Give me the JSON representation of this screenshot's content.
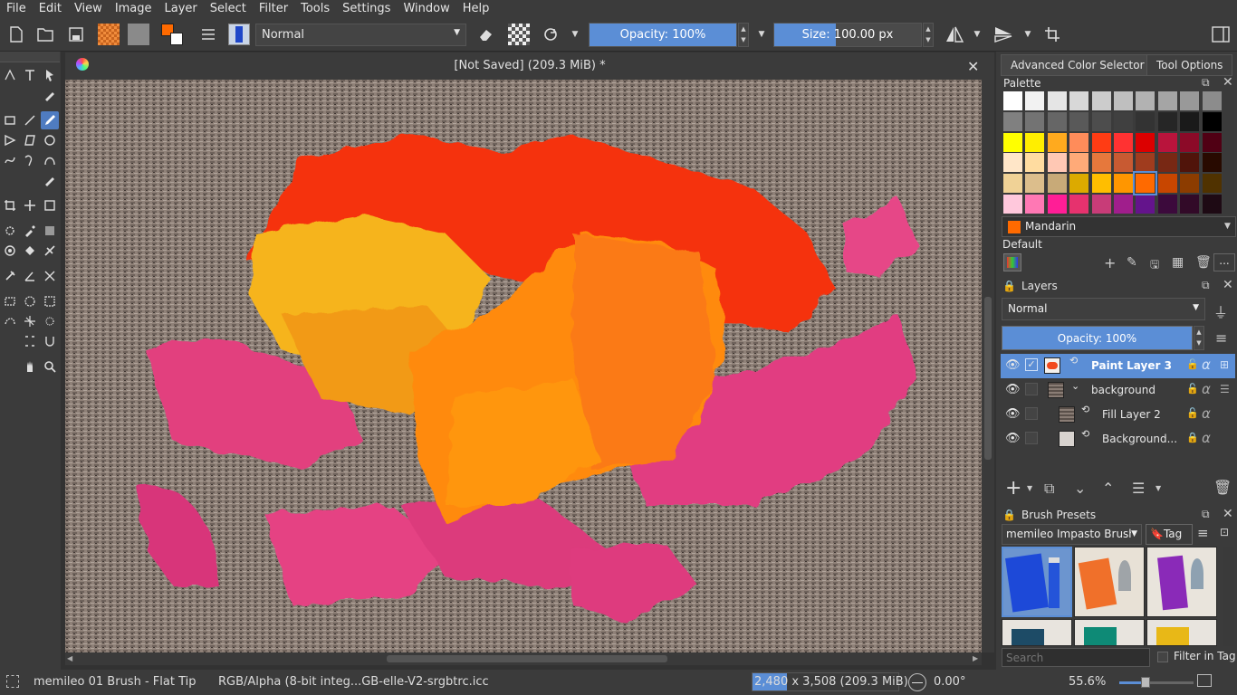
{
  "menu": [
    "File",
    "Edit",
    "View",
    "Image",
    "Layer",
    "Select",
    "Filter",
    "Tools",
    "Settings",
    "Window",
    "Help"
  ],
  "toolbar": {
    "blend_mode": "Normal",
    "opacity_label": "Opacity: 100%",
    "opacity_value": 1.0,
    "size_label": "Size: 100.00 px",
    "size_fill": 0.42,
    "fg_color": "#ff6a00",
    "bg_color": "#ffffff"
  },
  "document": {
    "title": "[Not Saved]  (209.3 MiB) *"
  },
  "dock": {
    "tabs": [
      "Advanced Color Selector",
      "Tool Options"
    ],
    "palette": {
      "title": "Palette",
      "selected_color_name": "Mandarin",
      "selected_color": "#ff6a00",
      "palette_name": "Default",
      "rows": [
        [
          "#ffffff",
          "#f2f2f2",
          "#e5e5e5",
          "#d8d8d8",
          "#cccccc",
          "#bfbfbf",
          "#b2b2b2",
          "#a5a5a5",
          "#999999",
          "#8c8c8c"
        ],
        [
          "#808080",
          "#737373",
          "#666666",
          "#595959",
          "#4d4d4d",
          "#404040",
          "#333333",
          "#262626",
          "#1a1a1a",
          "#000000"
        ],
        [
          "#ffff00",
          "#ffee00",
          "#ffaa1e",
          "#ff8c5a",
          "#ff3c14",
          "#ff3232",
          "#dc0000",
          "#b9143c",
          "#8c0a28",
          "#500014"
        ],
        [
          "#ffe6c8",
          "#ffdca0",
          "#ffc8b4",
          "#ffaa78",
          "#e6783c",
          "#c85a32",
          "#a03c1e",
          "#782814",
          "#50140a",
          "#280a00"
        ],
        [
          "#f0d296",
          "#dcbe8c",
          "#c8aa78",
          "#dcaa00",
          "#ffbe00",
          "#ff9600",
          "#ff6a00",
          "#c84600",
          "#8c3c00",
          "#503200"
        ],
        [
          "#ffc8dc",
          "#ff78b4",
          "#ff1e96",
          "#e6326e",
          "#c83c78",
          "#a01e8c",
          "#64148c",
          "#3c0a3c",
          "#320a28",
          "#1e0a14"
        ]
      ]
    },
    "layers": {
      "title": "Layers",
      "blend_mode": "Normal",
      "opacity_label": "Opacity:  100%",
      "items": [
        {
          "name": "Paint Layer 3",
          "selected": true
        },
        {
          "name": "background",
          "selected": false
        },
        {
          "name": "Fill Layer 2",
          "selected": false
        },
        {
          "name": "Background...",
          "selected": false
        }
      ]
    },
    "brush_presets": {
      "title": "Brush Presets",
      "tag_select": "memileo Impasto Brush",
      "tag_button": "Tag",
      "search_placeholder": "Search",
      "filter_label": "Filter in Tag"
    }
  },
  "status": {
    "brush": "memileo 01 Brush - Flat Tip",
    "color_profile": "RGB/Alpha (8-bit integ...GB-elle-V2-srgbtrc.icc",
    "dimensions": "2,480 x 3,508 (209.3 MiB)",
    "rotation": "0.00°",
    "zoom": "55.6%",
    "zoom_fill": 0.35
  }
}
